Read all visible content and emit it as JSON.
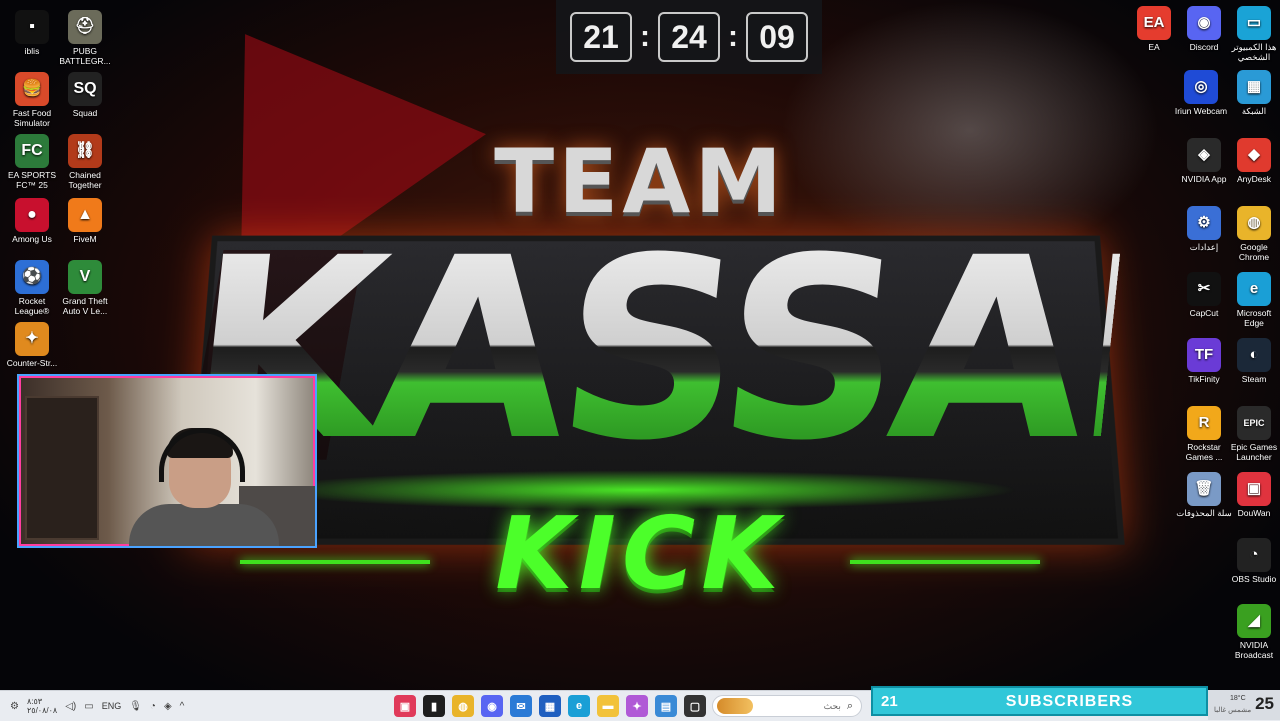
{
  "clock": {
    "hours": "21",
    "minutes": "24",
    "seconds": "09",
    "separator": ":"
  },
  "wallpaper": {
    "line1": "TEAM",
    "line2": "KASSAB",
    "line3": "KICK"
  },
  "desktop_icons_left": [
    {
      "label": "iblis",
      "icon": "blank-file-icon",
      "color": "#111111",
      "glyph": "▪"
    },
    {
      "label": "PUBG BATTLEGR...",
      "icon": "pubg-icon",
      "color": "#6b6b5a",
      "glyph": "⛑"
    },
    {
      "label": "Fast Food Simulator",
      "icon": "fast-food-icon",
      "color": "#d94a2a",
      "glyph": "🍔"
    },
    {
      "label": "Squad",
      "icon": "squad-icon",
      "color": "#222222",
      "glyph": "SQ"
    },
    {
      "label": "EA SPORTS FC™ 25",
      "icon": "fc25-icon",
      "color": "#2c7a3a",
      "glyph": "FC"
    },
    {
      "label": "Chained Together",
      "icon": "chained-together-icon",
      "color": "#b23a1a",
      "glyph": "⛓"
    },
    {
      "label": "Among Us",
      "icon": "among-us-icon",
      "color": "#c8102e",
      "glyph": "●"
    },
    {
      "label": "FiveM",
      "icon": "fivem-icon",
      "color": "#f07a1a",
      "glyph": "▲"
    },
    {
      "label": "Rocket League®",
      "icon": "rocket-league-icon",
      "color": "#2d6fd6",
      "glyph": "⚽"
    },
    {
      "label": "Grand Theft Auto V Le...",
      "icon": "gta-icon",
      "color": "#2e8b3a",
      "glyph": "V"
    },
    {
      "label": "Counter-Str...",
      "icon": "counter-strike-icon",
      "color": "#e08a1e",
      "glyph": "✦"
    }
  ],
  "desktop_icons_right": [
    {
      "label": "EA",
      "icon": "ea-icon",
      "color": "#e53c2e",
      "glyph": "EA"
    },
    {
      "label": "Discord",
      "icon": "discord-icon",
      "color": "#5865f2",
      "glyph": "◉"
    },
    {
      "label": "هذا الكمبيوتر الشخصي",
      "icon": "this-pc-icon",
      "color": "#1aa3d6",
      "glyph": "▭"
    },
    {
      "label": "Iriun Webcam",
      "icon": "iriun-webcam-icon",
      "color": "#1f4bd6",
      "glyph": "◎"
    },
    {
      "label": "الشبكة",
      "icon": "network-icon",
      "color": "#2a9ad6",
      "glyph": "▦"
    },
    {
      "label": "NVIDIA App",
      "icon": "nvidia-app-icon",
      "color": "#2a2a2a",
      "glyph": "◈"
    },
    {
      "label": "AnyDesk",
      "icon": "anydesk-icon",
      "color": "#e03a2e",
      "glyph": "◆"
    },
    {
      "label": "إعدادات",
      "icon": "settings-icon",
      "color": "#3a6fd6",
      "glyph": "⚙"
    },
    {
      "label": "Google Chrome",
      "icon": "chrome-icon",
      "color": "#e9b42a",
      "glyph": "◍"
    },
    {
      "label": "CapCut",
      "icon": "capcut-icon",
      "color": "#111111",
      "glyph": "✂"
    },
    {
      "label": "Microsoft Edge",
      "icon": "edge-icon",
      "color": "#1a9fd6",
      "glyph": "e"
    },
    {
      "label": "TikFinity",
      "icon": "tikfinity-icon",
      "color": "#6a3bd6",
      "glyph": "TF"
    },
    {
      "label": "Steam",
      "icon": "steam-icon",
      "color": "#1b2838",
      "glyph": "◐"
    },
    {
      "label": "Rockstar Games ...",
      "icon": "rockstar-icon",
      "color": "#f2a81a",
      "glyph": "R"
    },
    {
      "label": "Epic Games Launcher",
      "icon": "epic-games-icon",
      "color": "#2a2a2a",
      "glyph": "EPIC"
    },
    {
      "label": "سلة المحذوفات",
      "icon": "recycle-bin-icon",
      "color": "#7a9ac6",
      "glyph": "🗑"
    },
    {
      "label": "DouWan",
      "icon": "douwan-icon",
      "color": "#e0333e",
      "glyph": "▣"
    },
    {
      "label": "OBS Studio",
      "icon": "obs-icon",
      "color": "#222222",
      "glyph": "◔"
    },
    {
      "label": "NVIDIA Broadcast",
      "icon": "nvidia-broadcast-icon",
      "color": "#3aa020",
      "glyph": "◢"
    }
  ],
  "taskbar": {
    "time": "٨:٥٣",
    "date": "٢٥/٠٨/٠٨",
    "language": "ENG",
    "search_placeholder": "بحث",
    "apps": [
      {
        "icon": "kick-app-icon",
        "color": "#e03a5a",
        "glyph": "▣"
      },
      {
        "icon": "terminal-app-icon",
        "color": "#1e1e1e",
        "glyph": "▮"
      },
      {
        "icon": "chrome-taskbar-icon",
        "color": "#e9b42a",
        "glyph": "◍"
      },
      {
        "icon": "discord-taskbar-icon",
        "color": "#5865f2",
        "glyph": "◉"
      },
      {
        "icon": "mail-taskbar-icon",
        "color": "#2a7ad6",
        "glyph": "✉"
      },
      {
        "icon": "calendar-taskbar-icon",
        "color": "#1f5fc0",
        "glyph": "▦"
      },
      {
        "icon": "edge-taskbar-icon",
        "color": "#1a9fd6",
        "glyph": "e"
      },
      {
        "icon": "file-explorer-icon",
        "color": "#f2c23a",
        "glyph": "▬"
      },
      {
        "icon": "copilot-taskbar-icon",
        "color": "#b05ad6",
        "glyph": "✦"
      },
      {
        "icon": "widget-taskbar-icon",
        "color": "#3a8ad6",
        "glyph": "▤"
      },
      {
        "icon": "task-view-icon",
        "color": "#333333",
        "glyph": "▢"
      }
    ]
  },
  "subscribers": {
    "count": "21",
    "label": "SUBSCRIBERS"
  },
  "weather": {
    "temp": "18°C",
    "condition": "مشمس غالبا",
    "side_number": "25"
  }
}
